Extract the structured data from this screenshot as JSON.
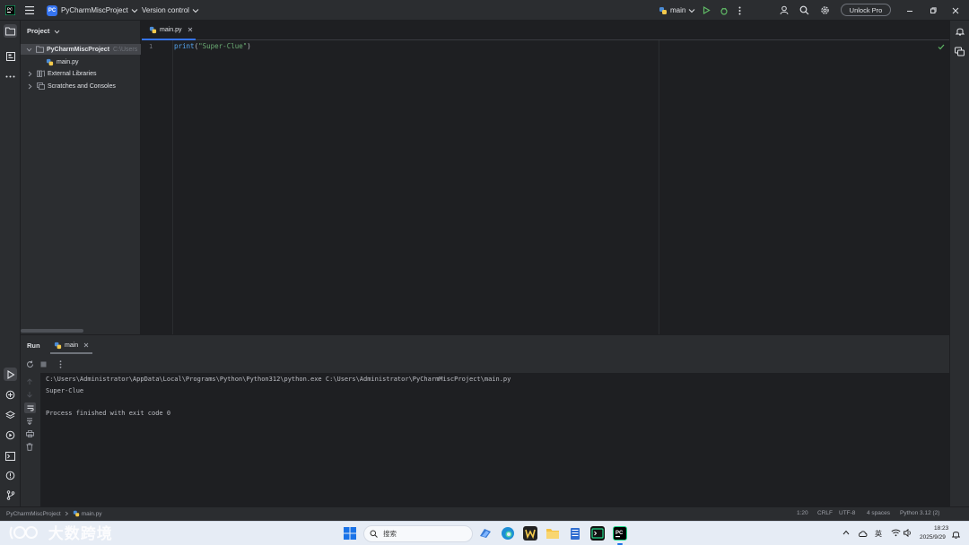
{
  "titlebar": {
    "project_badge": "PC",
    "project_name": "PyCharmMiscProject",
    "vcs_label": "Version control",
    "run_config": "main",
    "unlock_label": "Unlock Pro"
  },
  "project_panel": {
    "title": "Project",
    "root_name": "PyCharmMiscProject",
    "root_path": "C:\\Users",
    "file_item": "main.py",
    "external_libs": "External Libraries",
    "scratches": "Scratches and Consoles"
  },
  "editor": {
    "tab_label": "main.py",
    "line_number": "1",
    "code": {
      "fn": "print",
      "open": "(",
      "str": "\"Super-Clue\"",
      "close": ")"
    }
  },
  "run_panel": {
    "title": "Run",
    "tab_label": "main",
    "console_lines": [
      "C:\\Users\\Administrator\\AppData\\Local\\Programs\\Python\\Python312\\python.exe C:\\Users\\Administrator\\PyCharmMiscProject\\main.py",
      "Super-Clue",
      "",
      "Process finished with exit code 0"
    ]
  },
  "statusbar": {
    "breadcrumb_project": "PyCharmMiscProject",
    "breadcrumb_file": "main.py",
    "position": "1:20",
    "line_sep": "CRLF",
    "encoding": "UTF-8",
    "indent": "4 spaces",
    "interpreter": "Python 3.12 (2)"
  },
  "taskbar": {
    "search_placeholder": "搜索",
    "ime_label": "英",
    "time": "18:23",
    "date": "2025/9/29"
  },
  "watermark": "大数跨境",
  "colors": {
    "accent": "#3574f0",
    "run_green": "#5fb865",
    "string_green": "#6aab73",
    "function_blue": "#56a8f5"
  }
}
